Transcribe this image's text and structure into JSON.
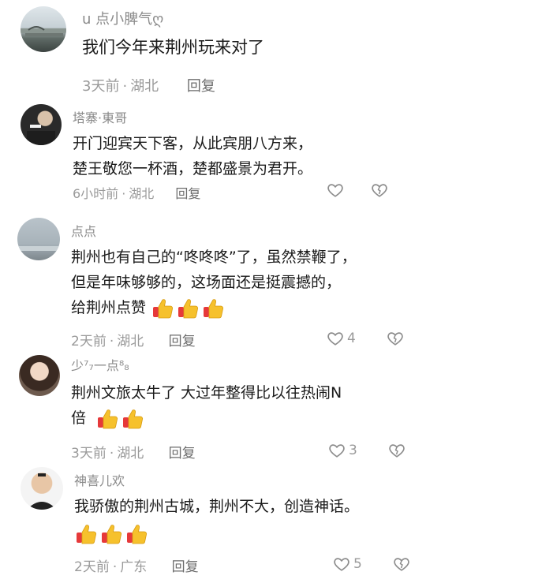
{
  "comments": [
    {
      "username": "u 点小脾气ღ",
      "lines": [
        "我们今年来荆州玩来对了"
      ],
      "time": "3天前",
      "location": "湖北",
      "reply": "回复",
      "likes": ""
    },
    {
      "username": "塔寨·東哥",
      "lines": [
        "开门迎宾天下客，从此宾朋八方来，",
        "楚王敬您一杯酒，楚都盛景为君开。"
      ],
      "time": "6小时前",
      "location": "湖北",
      "reply": "回复",
      "likes": ""
    },
    {
      "username": "点点",
      "lines": [
        "荆州也有自己的“咚咚咚”了，虽然禁鞭了，",
        "但是年味够够的，这场面还是挺震撼的，",
        "给荆州点赞"
      ],
      "time": "2天前",
      "location": "湖北",
      "reply": "回复",
      "likes": "4"
    },
    {
      "username": "少⁷₇一点⁸₈",
      "lines": [
        "荆州文旅太牛了 大过年整得比以往热闹N",
        "倍"
      ],
      "time": "3天前",
      "location": "湖北",
      "reply": "回复",
      "likes": "3"
    },
    {
      "username": "神喜儿欢",
      "lines": [
        "我骄傲的荆州古城，荆州不大，创造神话。"
      ],
      "time": "2天前",
      "location": "广东",
      "reply": "回复",
      "likes": "5"
    }
  ],
  "icons": {
    "like": "heart-outline-icon",
    "dislike": "broken-heart-icon",
    "emoji": "thumbs-up-emoji"
  },
  "colors": {
    "username": "#8a8a8a",
    "meta": "#9a9a9a",
    "thumb": "#f6c12c"
  }
}
